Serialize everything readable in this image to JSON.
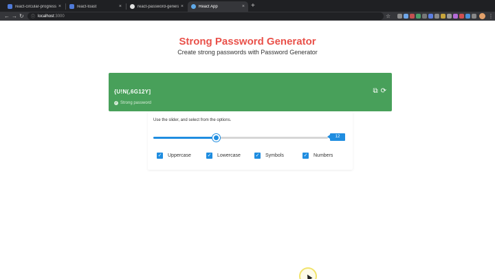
{
  "browser": {
    "tabs": [
      {
        "label": "react-circular-progress",
        "favicon_color": "#4f7ad8",
        "active": false
      },
      {
        "label": "react-toast",
        "favicon_color": "#4f7ad8",
        "active": false
      },
      {
        "label": "react-password-generator/Cr...",
        "favicon_color": "#e0e0e0",
        "active": false
      },
      {
        "label": "React App",
        "favicon_color": "#5fa9e8",
        "active": true
      }
    ],
    "new_tab": "+",
    "close_glyph": "×",
    "back_glyph": "←",
    "forward_glyph": "→",
    "reload_glyph": "↻",
    "info_glyph": "ⓘ",
    "url_host": "localhost",
    "url_port": ":3000",
    "star_glyph": "☆",
    "menu_glyph": "⋮",
    "extension_colors": [
      "#8d8d8d",
      "#6fa6e8",
      "#c45151",
      "#4b9f6b",
      "#777777",
      "#5c7ee0",
      "#8a8a8a",
      "#c7a43b",
      "#9a9a9a",
      "#b36bd6",
      "#d04f4f",
      "#4a90d9",
      "#888888"
    ]
  },
  "page": {
    "title": "Strong Password Generator",
    "subtitle": "Create strong passwords with Password Generator"
  },
  "password_card": {
    "password": "{U!N(,6G12Y]",
    "copy_glyph": "⧉",
    "refresh_glyph": "⟳",
    "check_glyph": "✓",
    "strength_label": "Strong password",
    "color": "#48a05a"
  },
  "options": {
    "hint": "Use the slider, and select from the options.",
    "length": 12,
    "length_min": 1,
    "length_max": 60,
    "accent_color": "#1f8de0",
    "checkmark": "✓",
    "checkboxes": [
      {
        "label": "Uppercase",
        "checked": true
      },
      {
        "label": "Lowercase",
        "checked": true
      },
      {
        "label": "Symbols",
        "checked": true
      },
      {
        "label": "Numbers",
        "checked": true
      }
    ]
  }
}
